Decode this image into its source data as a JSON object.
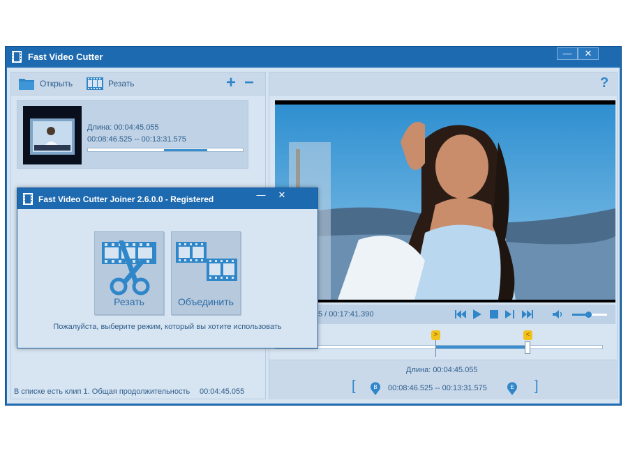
{
  "main_window": {
    "title": "Fast Video Cutter",
    "min_label": "—",
    "close_label": "✕"
  },
  "left_toolbar": {
    "open_label": "Открыть",
    "cut_label": "Резать",
    "add_label": "+",
    "remove_label": "−"
  },
  "clip": {
    "duration": "Длина: 00:04:45.055",
    "range": "00:08:46.525 -- 00:13:31.575",
    "progress_fraction_start": 0.49,
    "progress_fraction_end": 0.77
  },
  "status": {
    "text": "В списке есть клип 1. Общая продолжительность",
    "total": "00:04:45.055"
  },
  "right_toolbar": {
    "help_label": "?"
  },
  "player": {
    "time": "5 / 00:17:41.390",
    "volume_fraction": 0.45
  },
  "timeline": {
    "start_marker": ">",
    "end_marker": "<",
    "start_fraction": 0.49,
    "end_fraction": 0.77
  },
  "bottom_info": {
    "duration": "Длина: 00:04:45.055",
    "bracket_open": "[",
    "bracket_close": "]",
    "begin_marker": "B",
    "end_marker": "E",
    "range": "00:08:46.525 -- 00:13:31.575"
  },
  "dialog": {
    "title": "Fast Video Cutter Joiner 2.6.0.0 - Registered",
    "min_label": "—",
    "close_label": "✕",
    "cut_label": "Резать",
    "join_label": "Объединить",
    "hint": "Пожалуйста, выберите режим, который вы хотите использовать"
  },
  "colors": {
    "accent": "#1e6ab0",
    "icon_blue": "#2f86c8",
    "marker_yellow": "#f2c21a"
  },
  "icons": [
    "film-icon",
    "folder-icon",
    "film-strip-icon",
    "plus-icon",
    "minus-icon",
    "help-icon",
    "rewind-icon",
    "play-icon",
    "stop-icon",
    "forward-icon",
    "next-icon",
    "volume-icon",
    "scissors-icon",
    "join-icon",
    "begin-pin-icon",
    "end-pin-icon"
  ]
}
